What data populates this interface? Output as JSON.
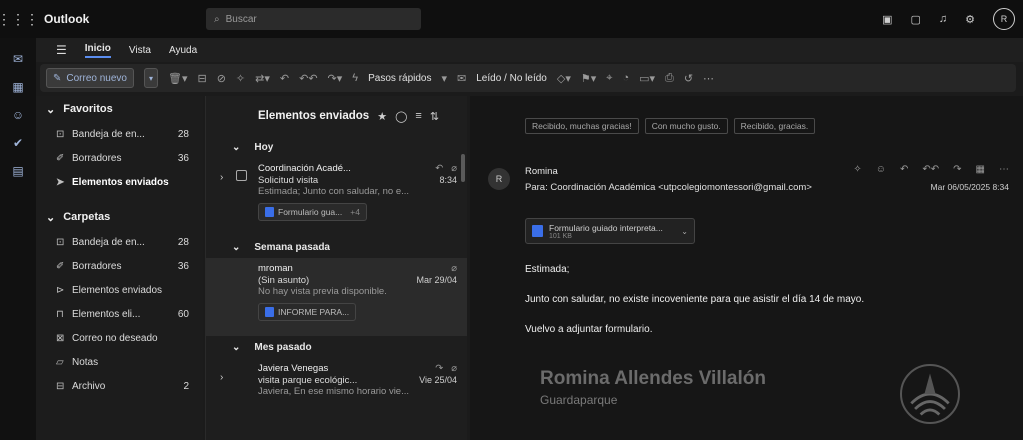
{
  "app": {
    "title": "Outlook"
  },
  "search": {
    "placeholder": "Buscar"
  },
  "avatar": {
    "initial": "R"
  },
  "menu": {
    "tabs": [
      "Inicio",
      "Vista",
      "Ayuda"
    ]
  },
  "ribbon": {
    "new_mail": "Correo nuevo",
    "quick_steps": "Pasos rápidos",
    "read_unread": "Leído / No leído"
  },
  "folders": {
    "favorites_title": "Favoritos",
    "favorites": [
      {
        "label": "Bandeja de en...",
        "count": "28",
        "icon": "inbox-icon"
      },
      {
        "label": "Borradores",
        "count": "36",
        "icon": "pencil-icon"
      },
      {
        "label": "Elementos enviados",
        "count": "",
        "icon": "send-icon"
      }
    ],
    "folders_title": "Carpetas",
    "items": [
      {
        "label": "Bandeja de en...",
        "count": "28"
      },
      {
        "label": "Borradores",
        "count": "36"
      },
      {
        "label": "Elementos enviados",
        "count": ""
      },
      {
        "label": "Elementos eli...",
        "count": "60"
      },
      {
        "label": "Correo no deseado",
        "count": ""
      },
      {
        "label": "Notas",
        "count": ""
      },
      {
        "label": "Archivo",
        "count": "2"
      }
    ]
  },
  "list": {
    "title": "Elementos enviados",
    "groups": [
      {
        "label": "Hoy",
        "messages": [
          {
            "sender": "Coordinación Acadé...",
            "subject": "Solicitud visita",
            "time": "8:34",
            "preview": "Estimada; Junto con saludar, no e...",
            "attachment": "Formulario gua...",
            "extra": "+4"
          }
        ]
      },
      {
        "label": "Semana pasada",
        "messages": [
          {
            "sender": "mroman",
            "subject": "(Sin asunto)",
            "time": "Mar 29/04",
            "preview": "No hay vista previa disponible.",
            "attachment": "INFORME PARA...",
            "extra": ""
          }
        ]
      },
      {
        "label": "Mes pasado",
        "messages": [
          {
            "sender": "Javiera Venegas",
            "subject": "visita parque ecológic...",
            "time": "Vie 25/04",
            "preview": "Javiera, En ese mismo horario vie...",
            "attachment": "",
            "extra": ""
          }
        ]
      }
    ]
  },
  "reading": {
    "quick_replies": [
      "Recibido, muchas gracias!",
      "Con mucho gusto.",
      "Recibido, gracias."
    ],
    "avatar_initial": "R",
    "from": "Romina",
    "to_label": "Para:",
    "to": "Coordinación Académica <utpcolegiomontessori@gmail.com>",
    "date": "Mar 06/05/2025 8:34",
    "attachment_name": "Formulario guiado interpreta...",
    "attachment_size": "101 KB",
    "body": [
      "Estimada;",
      "Junto con saludar, no existe incoveniente para que asistir el día 14 de mayo.",
      "Vuelvo a adjuntar formulario."
    ],
    "signature_name": "Romina Allendes Villalón",
    "signature_role": "Guardaparque"
  },
  "colors": {
    "accent": "#5b8def",
    "background": "#1b1b1b",
    "attachment": "#3a6ee8"
  }
}
